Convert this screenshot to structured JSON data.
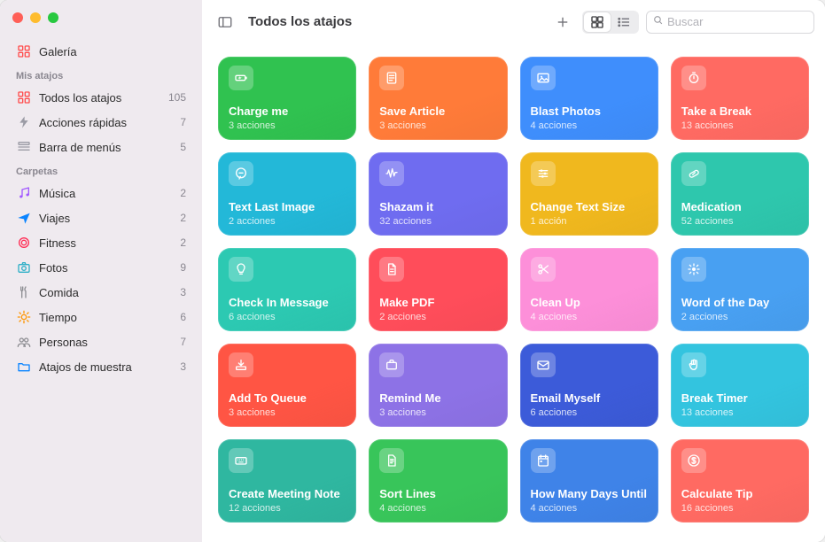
{
  "header": {
    "title": "Todos los atajos",
    "search_placeholder": "Buscar"
  },
  "sidebar": {
    "gallery_label": "Galería",
    "section_my": "Mis atajos",
    "section_folders": "Carpetas",
    "my": [
      {
        "label": "Todos los atajos",
        "count": "105",
        "icon": "grid",
        "color": "#ff4d4d"
      },
      {
        "label": "Acciones rápidas",
        "count": "7",
        "icon": "bolt",
        "color": "#9b9ba5"
      },
      {
        "label": "Barra de menús",
        "count": "5",
        "icon": "menu",
        "color": "#9b9ba5"
      }
    ],
    "folders": [
      {
        "label": "Música",
        "count": "2",
        "icon": "music",
        "color": "#a259ff"
      },
      {
        "label": "Viajes",
        "count": "2",
        "icon": "plane",
        "color": "#0a84ff"
      },
      {
        "label": "Fitness",
        "count": "2",
        "icon": "fitness",
        "color": "#ff2d55"
      },
      {
        "label": "Fotos",
        "count": "9",
        "icon": "camera",
        "color": "#30b0c7"
      },
      {
        "label": "Comida",
        "count": "3",
        "icon": "fork",
        "color": "#8e8e93"
      },
      {
        "label": "Tiempo",
        "count": "6",
        "icon": "sun",
        "color": "#ff9500"
      },
      {
        "label": "Personas",
        "count": "7",
        "icon": "people",
        "color": "#8e8e93"
      },
      {
        "label": "Atajos de muestra",
        "count": "3",
        "icon": "folder",
        "color": "#0a84ff"
      }
    ]
  },
  "actions_word": {
    "one": "acción",
    "other": "acciones"
  },
  "shortcuts": [
    {
      "name": "Charge me",
      "actions": 3,
      "icon": "battery",
      "color": "#30c250"
    },
    {
      "name": "Save Article",
      "actions": 3,
      "icon": "article",
      "color": "#ff7b39"
    },
    {
      "name": "Blast Photos",
      "actions": 4,
      "icon": "photo",
      "color": "#3f8efc"
    },
    {
      "name": "Take a Break",
      "actions": 13,
      "icon": "timer",
      "color": "#ff6a62"
    },
    {
      "name": "Text Last Image",
      "actions": 2,
      "icon": "chat",
      "color": "#23b8d8"
    },
    {
      "name": "Shazam it",
      "actions": 32,
      "icon": "wave",
      "color": "#6f6cf0"
    },
    {
      "name": "Change Text Size",
      "actions": 1,
      "icon": "sliders",
      "color": "#f0b81e"
    },
    {
      "name": "Medication",
      "actions": 52,
      "icon": "pill",
      "color": "#2ec7ad"
    },
    {
      "name": "Check In Message",
      "actions": 6,
      "icon": "bulb",
      "color": "#2cc9b2"
    },
    {
      "name": "Make PDF",
      "actions": 2,
      "icon": "doc",
      "color": "#ff4d5a"
    },
    {
      "name": "Clean Up",
      "actions": 4,
      "icon": "scissors",
      "color": "#fd8fd9"
    },
    {
      "name": "Word of the Day",
      "actions": 2,
      "icon": "bright",
      "color": "#48a0f2"
    },
    {
      "name": "Add To Queue",
      "actions": 3,
      "icon": "download",
      "color": "#ff5544"
    },
    {
      "name": "Remind Me",
      "actions": 3,
      "icon": "briefcase",
      "color": "#8d72e6"
    },
    {
      "name": "Email Myself",
      "actions": 6,
      "icon": "mail",
      "color": "#3c5bd9"
    },
    {
      "name": "Break Timer",
      "actions": 13,
      "icon": "hand",
      "color": "#33c4df"
    },
    {
      "name": "Create Meeting Note",
      "actions": 12,
      "icon": "keyboard",
      "color": "#2fb7a0"
    },
    {
      "name": "Sort Lines",
      "actions": 4,
      "icon": "docline",
      "color": "#38c55a"
    },
    {
      "name": "How Many Days Until",
      "actions": 4,
      "icon": "calendar",
      "color": "#3f83e8"
    },
    {
      "name": "Calculate Tip",
      "actions": 16,
      "icon": "dollar",
      "color": "#ff6a62"
    }
  ]
}
